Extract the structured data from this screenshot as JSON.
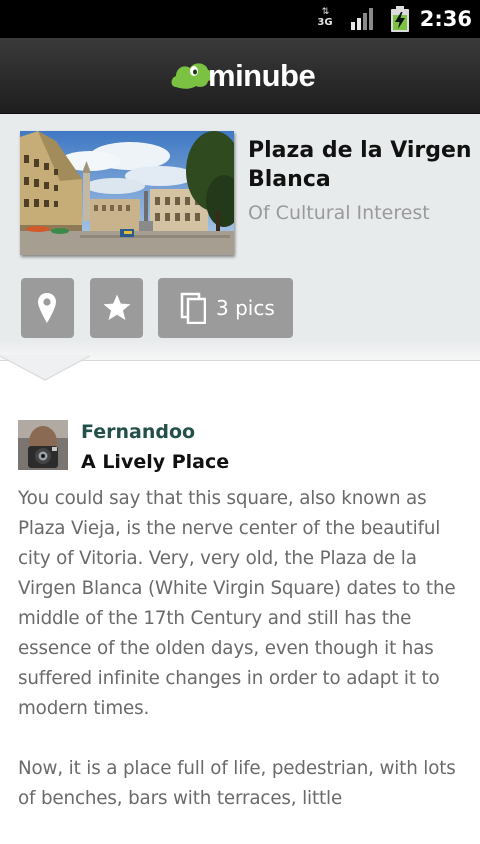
{
  "status_bar": {
    "network_label": "3G",
    "time": "2:36",
    "icons": [
      "network-3g-icon",
      "signal-icon",
      "battery-charging-icon"
    ]
  },
  "header": {
    "logo_text": "minube",
    "brand_color": "#7cc242"
  },
  "place": {
    "title": "Plaza de la Virgen Blanca",
    "category": "Of Cultural Interest",
    "pics_label": "3 pics",
    "actions": [
      "map-pin-icon",
      "star-icon",
      "pictures-icon"
    ]
  },
  "review": {
    "author": "Fernandoo",
    "title": "A Lively Place",
    "paragraphs": [
      "You could say that this square, also known as Plaza Vieja, is the nerve center of the beautiful city of Vitoria. Very, very old, the Plaza de la Virgen Blanca (White Virgin Square) dates to the middle of the 17th Century and still has the essence of the olden days, even though it has suffered infinite changes in order to adapt it to modern times.",
      "Now, it is a place full of life, pedestrian, with lots of benches, bars with terraces, little"
    ]
  },
  "colors": {
    "status_bar": "#000000",
    "header": "#2a2a2a",
    "card_background": "#e8ebec",
    "button_background": "#9b9b9b",
    "author_color": "#23504a",
    "body_text": "#6a6a6a"
  }
}
